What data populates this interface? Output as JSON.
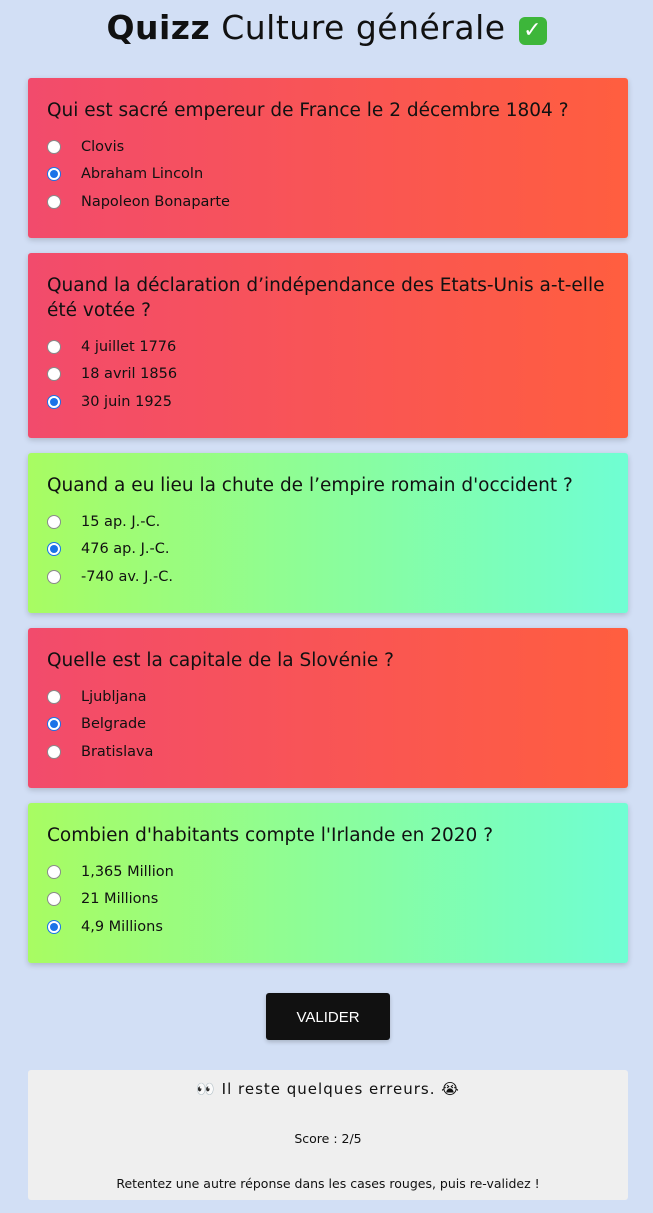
{
  "header": {
    "title_bold": "Quizz",
    "title_rest": "Culture générale",
    "title_icon": "check-mark-button-icon",
    "accent_wrong": "#f24b6c",
    "accent_right": "#6ffed3"
  },
  "questions": [
    {
      "text": "Qui est sacré empereur de France le 2 décembre 1804 ?",
      "status": "wrong",
      "options": [
        "Clovis",
        "Abraham Lincoln",
        "Napoleon Bonaparte"
      ],
      "selected": 1
    },
    {
      "text": "Quand la déclaration d’indépendance des Etats-Unis a-t-elle été votée ?",
      "status": "wrong",
      "options": [
        "4 juillet 1776",
        "18 avril 1856",
        "30 juin 1925"
      ],
      "selected": 2
    },
    {
      "text": "Quand a eu lieu la chute de l’empire romain d'occident ?",
      "status": "right",
      "options": [
        "15 ap. J.-C.",
        "476 ap. J.-C.",
        "-740 av. J.-C."
      ],
      "selected": 1
    },
    {
      "text": "Quelle est la capitale de la Slovénie ?",
      "status": "wrong",
      "options": [
        "Ljubljana",
        "Belgrade",
        "Bratislava"
      ],
      "selected": 1
    },
    {
      "text": "Combien d'habitants compte l'Irlande en 2020 ?",
      "status": "right",
      "options": [
        "1,365 Million",
        "21 Millions",
        "4,9 Millions"
      ],
      "selected": 2
    }
  ],
  "validate_label": "VALIDER",
  "result": {
    "eyes_emoji": "👀",
    "message": "Il reste quelques erreurs.",
    "crying_emoji": "😭",
    "score": "Score : 2/5",
    "hint": "Retentez une autre réponse dans les cases rouges, puis re-validez !"
  }
}
